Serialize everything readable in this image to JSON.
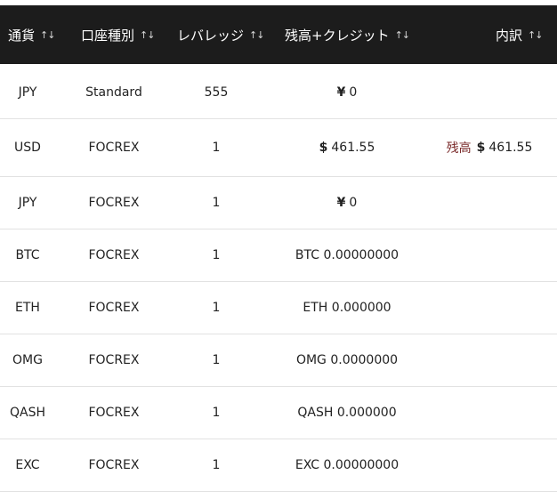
{
  "header": {
    "columns": [
      {
        "label": "通貨",
        "sort": "↑↓"
      },
      {
        "label": "口座種別",
        "sort": "↑↓"
      },
      {
        "label": "レバレッジ",
        "sort": "↑↓"
      },
      {
        "label": "残高+クレジット",
        "sort": "↑↓"
      },
      {
        "label": "内訳",
        "sort": "↑↓"
      }
    ]
  },
  "rows": [
    {
      "currency": "JPY",
      "type": "Standard",
      "leverage": "555",
      "sym": "¥",
      "balance": "0",
      "breakdown_label": "",
      "breakdown_sym": "",
      "breakdown_value": ""
    },
    {
      "currency": "USD",
      "type": "FOCREX",
      "leverage": "1",
      "sym": "$",
      "balance": "461.55",
      "breakdown_label": "残高",
      "breakdown_sym": "$",
      "breakdown_value": "461.55"
    },
    {
      "currency": "JPY",
      "type": "FOCREX",
      "leverage": "1",
      "sym": "¥",
      "balance": "0",
      "breakdown_label": "",
      "breakdown_sym": "",
      "breakdown_value": ""
    },
    {
      "currency": "BTC",
      "type": "FOCREX",
      "leverage": "1",
      "sym": "",
      "balance": "BTC 0.00000000",
      "breakdown_label": "",
      "breakdown_sym": "",
      "breakdown_value": ""
    },
    {
      "currency": "ETH",
      "type": "FOCREX",
      "leverage": "1",
      "sym": "",
      "balance": "ETH 0.000000",
      "breakdown_label": "",
      "breakdown_sym": "",
      "breakdown_value": ""
    },
    {
      "currency": "OMG",
      "type": "FOCREX",
      "leverage": "1",
      "sym": "",
      "balance": "OMG 0.0000000",
      "breakdown_label": "",
      "breakdown_sym": "",
      "breakdown_value": ""
    },
    {
      "currency": "QASH",
      "type": "FOCREX",
      "leverage": "1",
      "sym": "",
      "balance": "QASH 0.000000",
      "breakdown_label": "",
      "breakdown_sym": "",
      "breakdown_value": ""
    },
    {
      "currency": "EXC",
      "type": "FOCREX",
      "leverage": "1",
      "sym": "",
      "balance": "EXC 0.00000000",
      "breakdown_label": "",
      "breakdown_sym": "",
      "breakdown_value": ""
    }
  ]
}
